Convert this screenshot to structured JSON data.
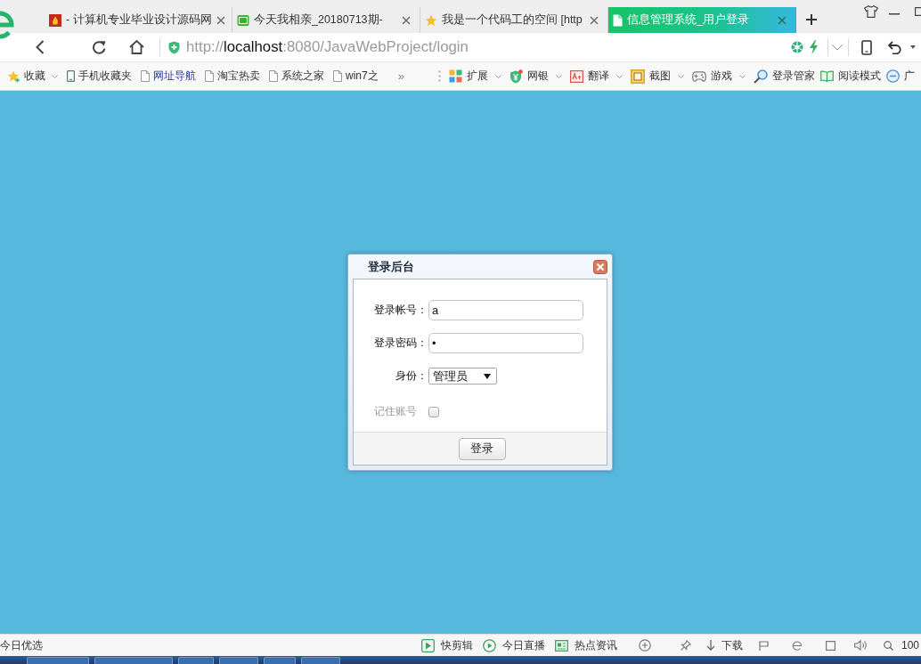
{
  "window": {
    "tabs": [
      {
        "title": "- 计算机专业毕业设计源码网",
        "selected": false
      },
      {
        "title": "今天我相亲_20180713期-",
        "selected": false
      },
      {
        "title": "我是一个代码工的空间 [http",
        "selected": false
      },
      {
        "title": "信息管理系统_用户登录",
        "selected": true
      }
    ]
  },
  "address_bar": {
    "url": "http://**localhost**:8080/JavaWebProject/login"
  },
  "bookmarks_bar": {
    "items": [
      {
        "label": "收藏",
        "kind": "favorites",
        "highlighted": false
      },
      {
        "label": "手机收藏夹",
        "kind": "mobile",
        "highlighted": false
      },
      {
        "label": "网址导航",
        "kind": "page",
        "highlighted": true
      },
      {
        "label": "淘宝热卖",
        "kind": "page",
        "highlighted": false
      },
      {
        "label": "系统之家",
        "kind": "page",
        "highlighted": false
      },
      {
        "label": "win7之",
        "kind": "page",
        "highlighted": false
      }
    ],
    "overflow": "»",
    "tools": [
      {
        "label": "扩展",
        "dropdown": true
      },
      {
        "label": "网银",
        "dropdown": true
      },
      {
        "label": "翻译",
        "dropdown": true
      },
      {
        "label": "截图",
        "dropdown": true
      },
      {
        "label": "游戏",
        "dropdown": true
      },
      {
        "label": "登录管家",
        "dropdown": false
      },
      {
        "label": "阅读模式",
        "dropdown": false
      },
      {
        "label": "广",
        "dropdown": false
      }
    ]
  },
  "dialog": {
    "title": "登录后台",
    "fields": [
      {
        "kind": "text",
        "label": "登录帐号：",
        "value": "a"
      },
      {
        "kind": "password",
        "label": "登录密码：",
        "value": "•"
      },
      {
        "kind": "select",
        "label": "身份：",
        "value": "管理员"
      },
      {
        "kind": "checkbox",
        "label": "记住账号",
        "checked": false
      }
    ],
    "submit": "登录"
  },
  "status_bar": {
    "left": "今日优选",
    "links": [
      {
        "label": "快剪辑"
      },
      {
        "label": "今日直播"
      },
      {
        "label": "热点资讯"
      }
    ],
    "download": "下载",
    "zoom": "100"
  }
}
